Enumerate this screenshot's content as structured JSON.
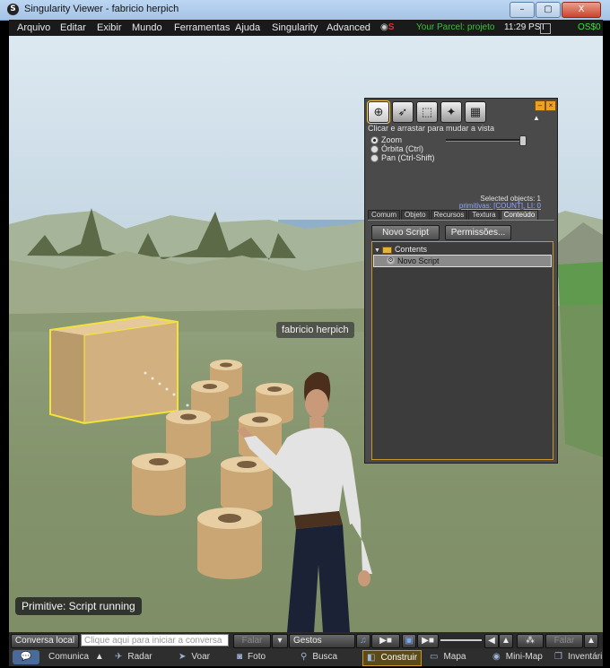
{
  "window": {
    "title": "Singularity Viewer - fabricio herpich",
    "minimize": "–",
    "maximize": "▢",
    "close": "X"
  },
  "menu": {
    "items": [
      "Arquivo",
      "Editar",
      "Exibir",
      "Mundo",
      "Ferramentas",
      "Ajuda",
      "Singularity",
      "Advanced"
    ],
    "parcel": "Your Parcel: projeto",
    "time": "11:29 PST",
    "balance": "OS$0"
  },
  "scene": {
    "avatar_name": "fabricio herpich",
    "status_toast": "Primitive: Script running"
  },
  "build": {
    "tools": [
      "focus-tool",
      "move-tool",
      "edit-tool",
      "create-tool",
      "land-tool"
    ],
    "hint": "Clicar e arrastar para mudar a vista",
    "modes": [
      {
        "label": "Zoom",
        "selected": true
      },
      {
        "label": "Órbita (Ctrl)",
        "selected": false
      },
      {
        "label": "Pan (Ctrl-Shift)",
        "selected": false
      }
    ],
    "zoom_level": 1.0,
    "selected_objects": "Selected objects: 1",
    "primitives": "primitivas: [COUNT], LI: 0",
    "tabs": [
      "Comum",
      "Objeto",
      "Recursos",
      "Textura",
      "Conteúdo"
    ],
    "active_tab": "Conteúdo",
    "new_script_label": "Novo Script",
    "permissions_label": "Permissões...",
    "tree": {
      "folder": "Contents",
      "item": "Novo Script"
    }
  },
  "chatbar": {
    "local_chat": "Conversa local",
    "placeholder": "Clique aqui para iniciar a conversa",
    "speak": "Falar",
    "gestures": "Gestos",
    "speak2": "Falar"
  },
  "toolbar": {
    "items": [
      "Comunica",
      "Radar",
      "Voar",
      "Foto",
      "Busca",
      "Construir",
      "Mapa",
      "Mini-Map",
      "Inventári"
    ],
    "active": "Construir"
  },
  "colors": {
    "selection_outline": "#f2e23a",
    "cylinder": "#d9b98a",
    "panel": "#4a4a4a",
    "accent": "#c8962a"
  }
}
